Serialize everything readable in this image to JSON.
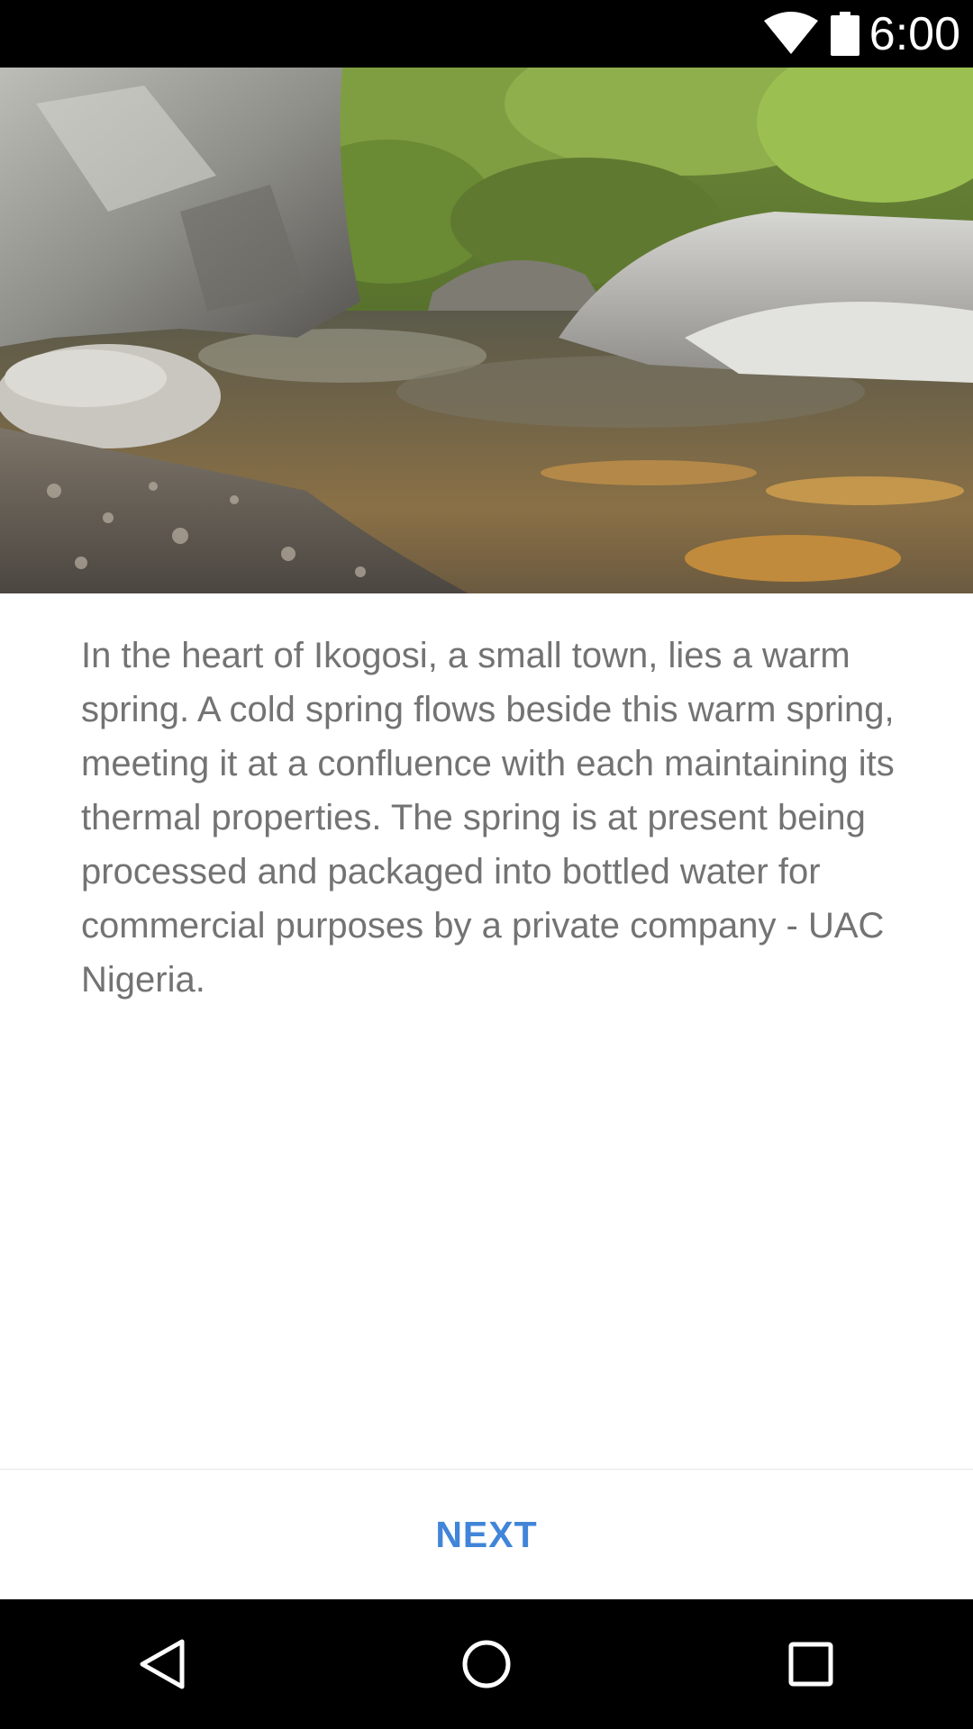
{
  "status_bar": {
    "time": "6:00",
    "icons": [
      "wifi-icon",
      "battery-icon"
    ]
  },
  "hero_image": {
    "subject": "warm spring pool among rocks"
  },
  "content": {
    "description": "In the heart of Ikogosi, a small town, lies a warm spring. A cold spring flows beside this warm spring, meeting it at a confluence with each maintaining its thermal properties. The spring is at present being processed and packaged into bottled water for commercial purposes by a private company - UAC Nigeria."
  },
  "actions": {
    "next_label": "NEXT"
  },
  "nav_bar": {
    "icons": [
      "back-icon",
      "home-icon",
      "recents-icon"
    ]
  },
  "colors": {
    "accent": "#4185d8",
    "text": "#737373",
    "system_bars": "#000000"
  }
}
